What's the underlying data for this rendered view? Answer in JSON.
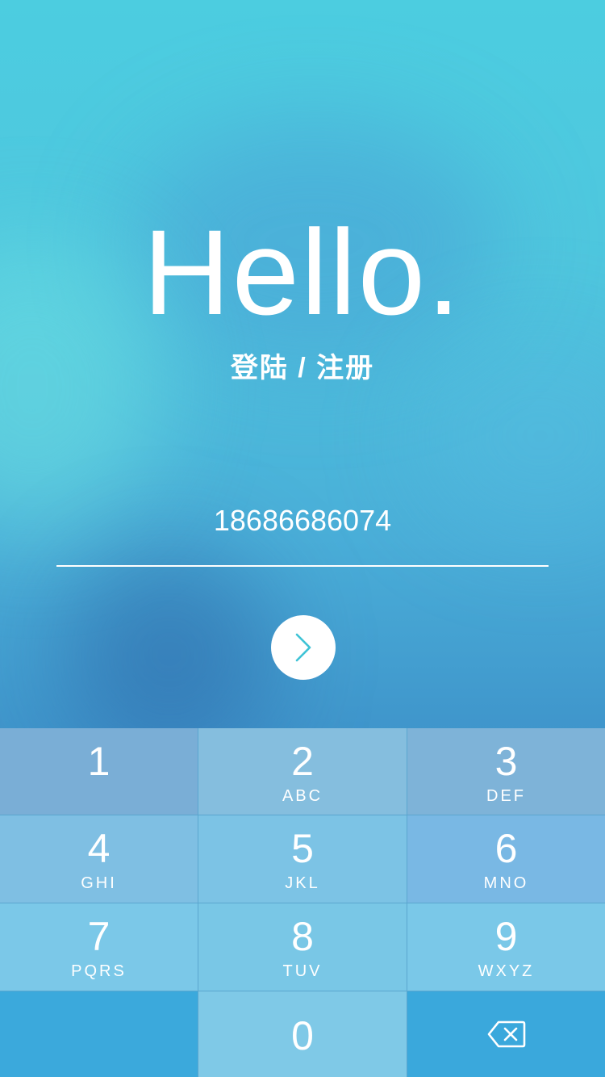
{
  "hero": {
    "title": "Hello.",
    "subtitle": "登陆 / 注册"
  },
  "phone_input": {
    "value": "18686686074"
  },
  "next_button": {
    "icon": "chevron-right-icon",
    "icon_color": "#3fc3d6"
  },
  "keypad": {
    "keys": [
      {
        "digit": "1",
        "letters": ""
      },
      {
        "digit": "2",
        "letters": "ABC"
      },
      {
        "digit": "3",
        "letters": "DEF"
      },
      {
        "digit": "4",
        "letters": "GHI"
      },
      {
        "digit": "5",
        "letters": "JKL"
      },
      {
        "digit": "6",
        "letters": "MNO"
      },
      {
        "digit": "7",
        "letters": "PQRS"
      },
      {
        "digit": "8",
        "letters": "TUV"
      },
      {
        "digit": "9",
        "letters": "WXYZ"
      },
      {
        "digit": "0",
        "letters": ""
      }
    ],
    "backspace_icon": "backspace-icon"
  },
  "colors": {
    "text": "#ffffff",
    "background_top": "#4ccde0",
    "background_bottom": "#3a7fc0"
  }
}
